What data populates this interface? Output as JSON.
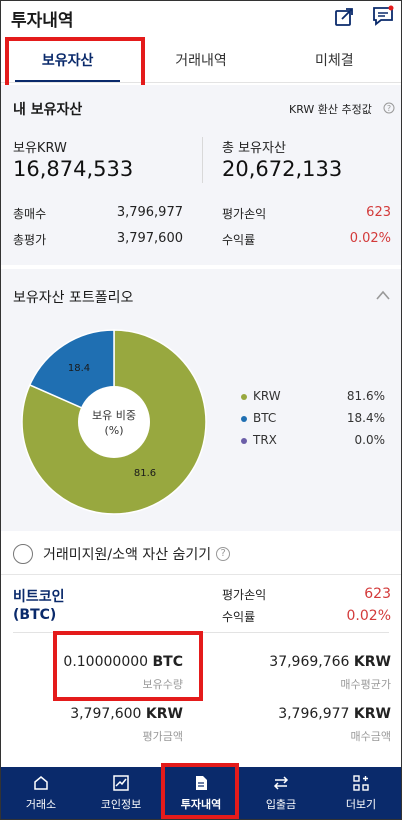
{
  "header": {
    "title": "투자내역",
    "share_icon": "share-icon",
    "chat_icon": "chat-icon"
  },
  "tabs": [
    {
      "label": "보유자산",
      "active": true
    },
    {
      "label": "거래내역",
      "active": false
    },
    {
      "label": "미체결",
      "active": false
    }
  ],
  "summary": {
    "title": "내 보유자산",
    "krw_note": "KRW 환산 추정값",
    "held_krw_label": "보유KRW",
    "held_krw_value": "16,874,533",
    "total_assets_label": "총 보유자산",
    "total_assets_value": "20,672,133",
    "total_buy_label": "총매수",
    "total_buy_value": "3,796,977",
    "total_eval_label": "총평가",
    "total_eval_value": "3,797,600",
    "pnl_label": "평가손익",
    "pnl_value": "623",
    "return_label": "수익률",
    "return_value": "0.02%"
  },
  "portfolio": {
    "title": "보유자산 포트폴리오",
    "center_label_1": "보유 비중",
    "center_label_2": "(%)",
    "slice_label_krw": "81.6",
    "slice_label_btc": "18.4",
    "legend": [
      {
        "name": "KRW",
        "value": "81.6%",
        "color": "#98a83f"
      },
      {
        "name": "BTC",
        "value": "18.4%",
        "color": "#1f6fb2"
      },
      {
        "name": "TRX",
        "value": "0.0%",
        "color": "#6b5ea8"
      }
    ]
  },
  "chart_data": {
    "type": "pie",
    "categories": [
      "KRW",
      "BTC",
      "TRX"
    ],
    "values": [
      81.6,
      18.4,
      0.0
    ],
    "title": "보유자산 포트폴리오"
  },
  "toggle": {
    "label": "거래미지원/소액 자산 숨기기"
  },
  "coin": {
    "name": "비트코인",
    "symbol": "(BTC)",
    "pnl_label": "평가손익",
    "pnl_value": "623",
    "return_label": "수익률",
    "return_value": "0.02%",
    "qty_value": "0.10000000",
    "qty_unit": "BTC",
    "qty_label": "보유수량",
    "avg_price_value": "37,969,766",
    "avg_price_unit": "KRW",
    "avg_price_label": "매수평균가",
    "eval_value": "3,797,600",
    "eval_unit": "KRW",
    "eval_label": "평가금액",
    "buy_value": "3,796,977",
    "buy_unit": "KRW",
    "buy_label": "매수금액"
  },
  "nav": [
    {
      "label": "거래소",
      "icon": "home-icon"
    },
    {
      "label": "코인정보",
      "icon": "chart-icon"
    },
    {
      "label": "투자내역",
      "icon": "document-icon",
      "active": true
    },
    {
      "label": "입출금",
      "icon": "transfer-icon"
    },
    {
      "label": "더보기",
      "icon": "more-grid-icon"
    }
  ]
}
